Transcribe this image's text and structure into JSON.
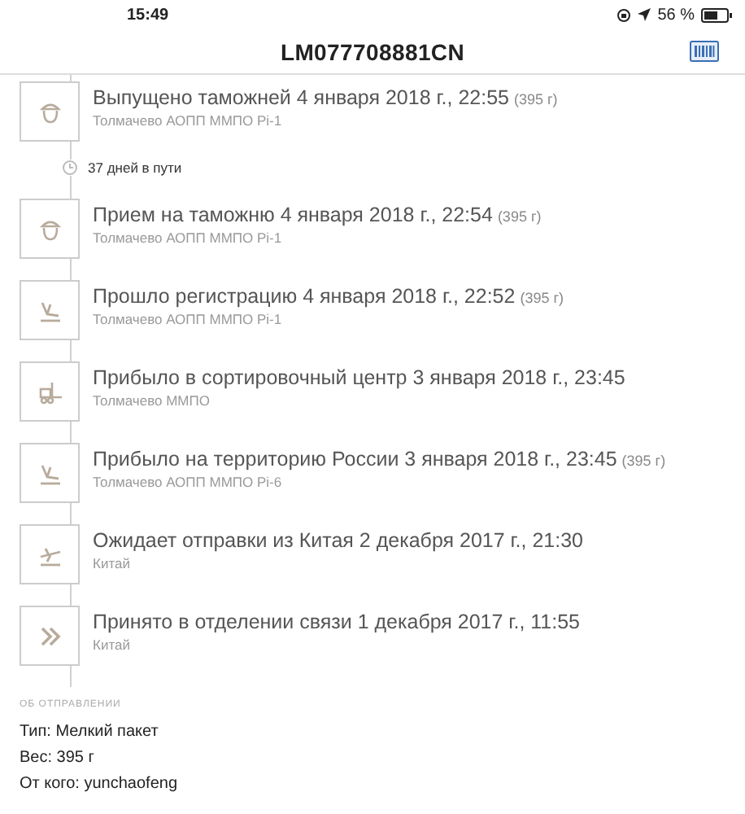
{
  "status_bar": {
    "time": "15:49",
    "battery": "56 %"
  },
  "header": {
    "title": "LM077708881CN"
  },
  "timeline": [
    {
      "kind": "customs",
      "title": "Выпущено таможней 4 января 2018 г., 22:55",
      "weight": "(395 г)",
      "place": "Толмачево АОПП ММПО Pi-1"
    },
    {
      "kind": "duration",
      "title": "37 дней в пути"
    },
    {
      "kind": "customs",
      "title": "Прием на таможню 4 января 2018 г., 22:54",
      "weight": "(395 г)",
      "place": "Толмачево АОПП ММПО Pi-1"
    },
    {
      "kind": "arrival",
      "title": "Прошло регистрацию 4 января 2018 г., 22:52",
      "weight": "(395 г)",
      "place": "Толмачево АОПП ММПО Pi-1"
    },
    {
      "kind": "sorting",
      "title": "Прибыло в сортировочный центр 3 января 2018 г., 23:45",
      "place": "Толмачево ММПО"
    },
    {
      "kind": "arrival",
      "title": "Прибыло на территорию России 3 января 2018 г., 23:45",
      "weight": "(395 г)",
      "place": "Толмачево АОПП ММПО Pi-6"
    },
    {
      "kind": "departure",
      "title": "Ожидает отправки из Китая 2 декабря 2017 г., 21:30",
      "place": "Китай"
    },
    {
      "kind": "accepted",
      "title": "Принято в отделении связи 1 декабря 2017 г., 11:55",
      "place": "Китай"
    }
  ],
  "about": {
    "heading": "ОБ ОТПРАВЛЕНИИ",
    "rows": [
      "Тип: Мелкий пакет",
      "Вес: 395 г",
      "От кого: yunchaofeng"
    ]
  }
}
